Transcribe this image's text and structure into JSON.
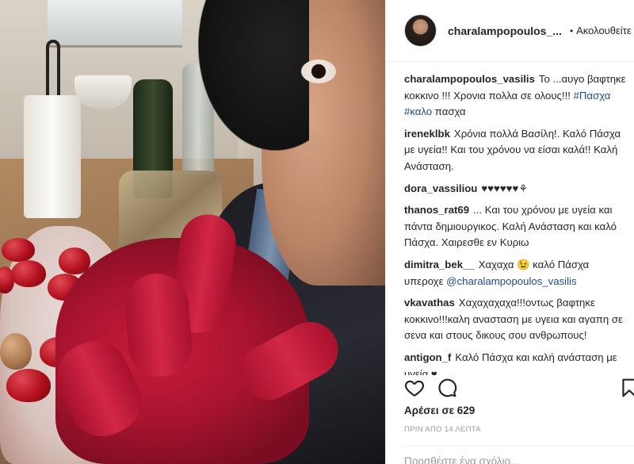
{
  "post": {
    "username_short": "charalampopoulos_...",
    "dot": "•",
    "follow_label": "Ακολουθείτε",
    "caption": {
      "user": "charalampopoulos_vasilis",
      "text_before": "Το ...αυγο βαφτηκε κοκκινο !!! Χρονια πολλα σε ολους!!!",
      "hashtag1": "#Πασχα",
      "hashtag2": "#καλο",
      "text_after": "πασχα"
    },
    "comments": [
      {
        "user": "ireneklbk",
        "text": "Χρόνια πολλά Βασίλη!. Καλό Πάσχα με υγεία!! Και του χρόνου να είσαι καλά!! Καλή Ανάσταση."
      },
      {
        "user": "dora_vassiliou",
        "text": "♥♥♥♥♥♥⚘"
      },
      {
        "user": "thanos_rat69",
        "text": "... Και του χρόνου με υγεία και πάντα δημιουργικος. Καλή Ανάσταση και καλό Πάσχα. Χαιρεσθε εν Κυριω"
      },
      {
        "user": "dimitra_bek__",
        "text_before": "Χαχαχα 😉 καλό Πάσχα υπεροχε",
        "mention": "@charalampopoulos_vasilis"
      },
      {
        "user": "vkavathas",
        "text": "Χαχαχαχαχα!!!οντως βαφτηκε κοκκινο!!!καλη ανασταση με υγεια και αγαπη σε σενα και στους δικους σου ανθρωπους!"
      },
      {
        "user": "antigon_f",
        "text": "Καλό Πάσχα και καλή ανάσταση με υγεία ♥"
      }
    ],
    "likes": "Αρέσει σε 629",
    "time": "ΠΡΙΝ ΑΠΟ 14 ΛΕΠΤΑ",
    "add_comment_placeholder": "Προσθέστε ένα σχόλιο..."
  },
  "icons": {
    "like": "heart-icon",
    "comment": "comment-icon",
    "save": "bookmark-icon"
  }
}
